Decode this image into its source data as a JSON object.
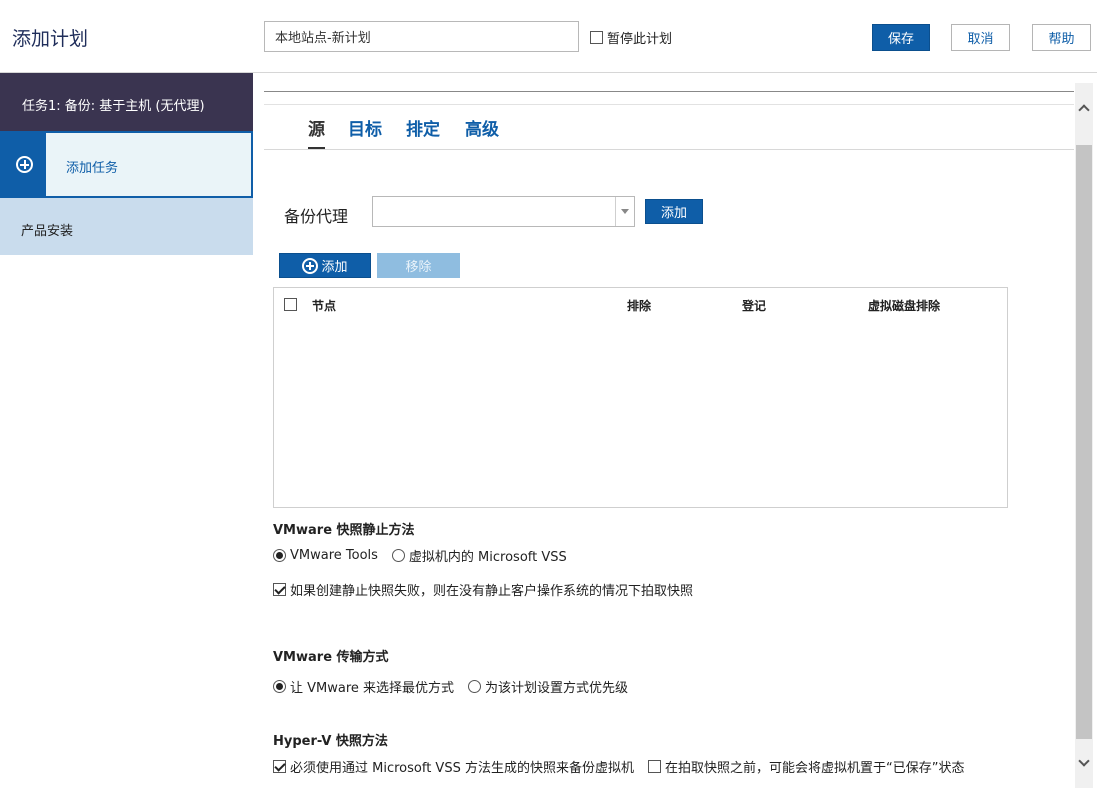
{
  "header": {
    "title": "添加计划",
    "plan_name_value": "本地站点-新计划",
    "pause_label": "暂停此计划",
    "pause_checked": false,
    "save_label": "保存",
    "cancel_label": "取消",
    "help_label": "帮助"
  },
  "sidebar": {
    "task_label": "任务1: 备份: 基于主机 (无代理)",
    "add_task_label": "添加任务",
    "product_install_label": "产品安装"
  },
  "tabs": [
    {
      "label": "源",
      "active": true
    },
    {
      "label": "目标",
      "active": false
    },
    {
      "label": "排定",
      "active": false
    },
    {
      "label": "高级",
      "active": false
    }
  ],
  "backup_agent": {
    "label": "备份代理",
    "value": "",
    "add_label": "添加"
  },
  "node_toolbar": {
    "add_label": "添加",
    "remove_label": "移除"
  },
  "node_table": {
    "columns": [
      "节点",
      "排除",
      "登记",
      "虚拟磁盘排除"
    ],
    "rows": []
  },
  "vmware_quiesce": {
    "title": "VMware 快照静止方法",
    "option_tools": "VMware Tools",
    "option_vss": "虚拟机内的 Microsoft VSS",
    "fallback_label": "如果创建静止快照失败，则在没有静止客户操作系统的情况下拍取快照"
  },
  "vmware_transport": {
    "title": "VMware 传输方式",
    "option_auto": "让 VMware 来选择最优方式",
    "option_priority": "为该计划设置方式优先级"
  },
  "hyperv_snapshot": {
    "title": "Hyper-V 快照方法",
    "vss_label": "必须使用通过 Microsoft VSS 方法生成的快照来备份虚拟机",
    "saved_state_label": "在拍取快照之前，可能会将虚拟机置于“已保存”状态"
  },
  "colors": {
    "primary": "#0f5ea8",
    "sidebar_dark": "#3a3450",
    "sidebar_light": "#c9dced"
  }
}
